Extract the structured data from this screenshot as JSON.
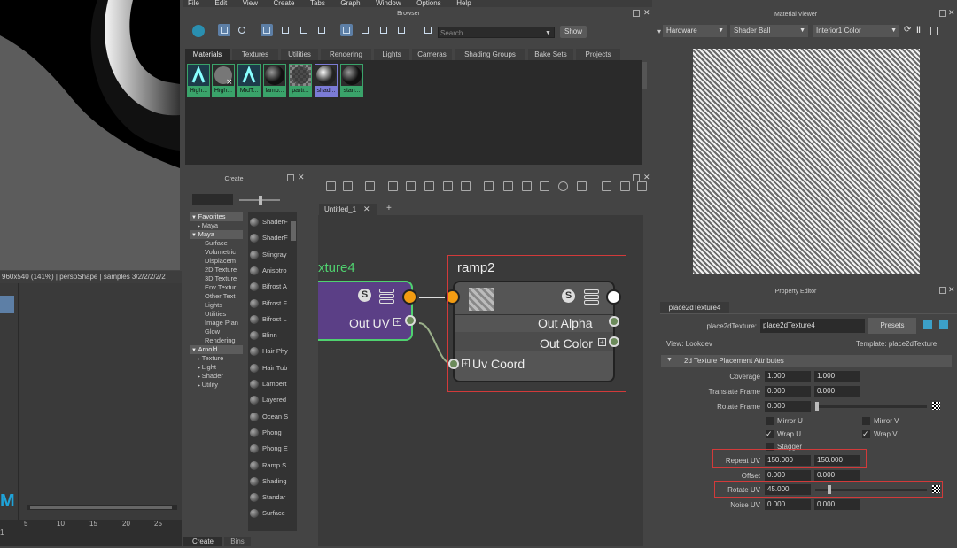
{
  "viewport": {
    "status_text": "960x540 (141%) | perspShape  | samples 3/2/2/2/2/2",
    "timeline_ticks": [
      "5",
      "10",
      "15",
      "20",
      "25"
    ],
    "frame_left": "1"
  },
  "menubar": [
    "File",
    "Edit",
    "View",
    "Create",
    "Tabs",
    "Graph",
    "Window",
    "Options",
    "Help"
  ],
  "browser": {
    "title": "Browser",
    "search_placeholder": "Search...",
    "show_label": "Show",
    "tabs": [
      "Materials",
      "Textures",
      "Utilities",
      "Rendering",
      "Lights",
      "Cameras",
      "Shading Groups",
      "Bake Sets",
      "Projects"
    ],
    "swatches": [
      "High...",
      "High...",
      "MidT...",
      "lamb...",
      "parti...",
      "shad...",
      "stan..."
    ]
  },
  "create": {
    "title": "Create",
    "tree": [
      {
        "label": "Favorites",
        "kind": "header"
      },
      {
        "label": "Maya",
        "kind": "child-arrow"
      },
      {
        "label": "Maya",
        "kind": "header"
      },
      {
        "label": "Surface",
        "kind": "child"
      },
      {
        "label": "Volumetric",
        "kind": "child"
      },
      {
        "label": "Displacem",
        "kind": "child"
      },
      {
        "label": "2D Texture",
        "kind": "child"
      },
      {
        "label": "3D Texture",
        "kind": "child"
      },
      {
        "label": "Env Textur",
        "kind": "child"
      },
      {
        "label": "Other Text",
        "kind": "child"
      },
      {
        "label": "Lights",
        "kind": "child"
      },
      {
        "label": "Utilities",
        "kind": "child"
      },
      {
        "label": "Image Plan",
        "kind": "child"
      },
      {
        "label": "Glow",
        "kind": "child"
      },
      {
        "label": "Rendering",
        "kind": "child"
      },
      {
        "label": "Arnold",
        "kind": "header"
      },
      {
        "label": "Texture",
        "kind": "child-arrow"
      },
      {
        "label": "Light",
        "kind": "child-arrow"
      },
      {
        "label": "Shader",
        "kind": "child-arrow"
      },
      {
        "label": "Utility",
        "kind": "child-arrow"
      }
    ],
    "list": [
      "ShaderF",
      "ShaderF",
      "Stingray",
      "Anisotro",
      "Bifrost A",
      "Bifrost F",
      "Bifrost L",
      "Blinn",
      "Hair Phy",
      "Hair Tub",
      "Lambert",
      "Layered",
      "Ocean S",
      "Phong",
      "Phong E",
      "Ramp S",
      "Shading",
      "Standar",
      "Surface"
    ],
    "bottom_tabs": [
      "Create",
      "Bins"
    ]
  },
  "node_editor": {
    "tab_label": "Untitled_1",
    "add_tab": "+",
    "node_left": {
      "title": "xture4",
      "port": "Out UV"
    },
    "node_right": {
      "title": "ramp2",
      "ports": [
        "Out Alpha",
        "Out Color",
        "Uv Coord"
      ]
    },
    "s_badge": "S"
  },
  "material_viewer": {
    "title": "Material Viewer",
    "renderer": "Hardware",
    "shape": "Shader Ball",
    "env": "Interior1 Color"
  },
  "property_editor": {
    "title": "Property Editor",
    "node_tab": "place2dTexture4",
    "node_label": "place2dTexture:",
    "node_name": "place2dTexture4",
    "presets": "Presets",
    "view": "View: Lookdev",
    "template": "Template: place2dTexture",
    "section": "2d Texture Placement Attributes",
    "rows": [
      {
        "label": "Coverage",
        "v1": "1.000",
        "v2": "1.000"
      },
      {
        "label": "Translate Frame",
        "v1": "0.000",
        "v2": "0.000"
      },
      {
        "label": "Rotate Frame",
        "v1": "0.000",
        "v2": ""
      },
      {
        "label": "Repeat UV",
        "v1": "150.000",
        "v2": "150.000"
      },
      {
        "label": "Offset",
        "v1": "0.000",
        "v2": "0.000"
      },
      {
        "label": "Rotate UV",
        "v1": "45.000",
        "v2": ""
      },
      {
        "label": "Noise UV",
        "v1": "0.000",
        "v2": "0.000"
      }
    ],
    "checkboxes": [
      {
        "label": "Mirror U",
        "checked": false
      },
      {
        "label": "Mirror V",
        "checked": false
      },
      {
        "label": "Wrap U",
        "checked": true
      },
      {
        "label": "Wrap V",
        "checked": true
      },
      {
        "label": "Stagger",
        "checked": false
      }
    ]
  },
  "colors": {
    "accent_highlight": "#d23a3a",
    "node_purple": "#5b3f86",
    "node_border_green": "#4fd16f",
    "port_orange": "#f39c12",
    "swatch_green": "#3aa36a"
  }
}
